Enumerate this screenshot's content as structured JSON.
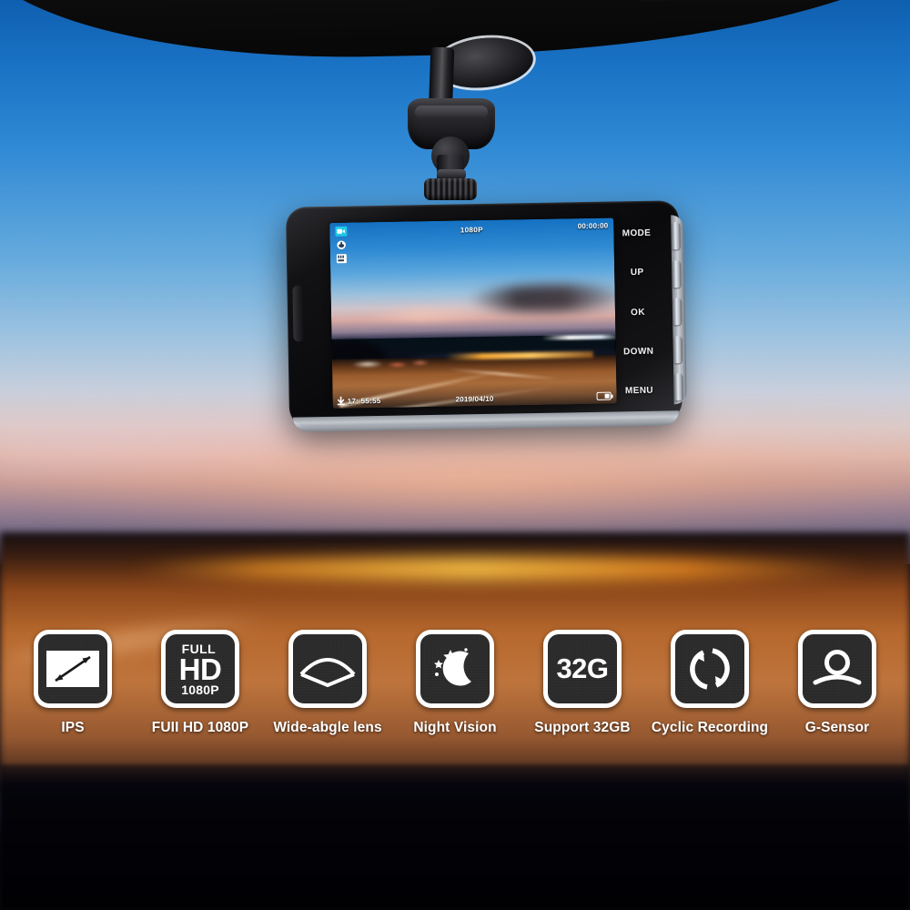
{
  "scene": {
    "title": "Car Dash Cam Product Feature Image",
    "setting": "dash camera mounted on windshield at sunset"
  },
  "device": {
    "name": "dash-cam",
    "screen": {
      "osd": {
        "resolution": "1080P",
        "record_timer": "00:00:00",
        "time": "17: 55:55",
        "date": "2019/04/10",
        "status_icons": [
          {
            "name": "video-record-icon",
            "color": "#20c8e8"
          },
          {
            "name": "microphone-icon",
            "color": "#ffffff"
          },
          {
            "name": "sd-card-icon",
            "color": "#ffffff"
          }
        ],
        "battery_icon": "battery-icon"
      },
      "content": "night highway driving scene with motion-blurred light trails"
    },
    "buttons": [
      {
        "label": "MODE",
        "name": "mode-button"
      },
      {
        "label": "UP",
        "name": "up-button"
      },
      {
        "label": "OK",
        "name": "ok-button"
      },
      {
        "label": "DOWN",
        "name": "down-button"
      },
      {
        "label": "MENU",
        "name": "menu-button"
      }
    ]
  },
  "mount": {
    "name": "suction-cup-mount",
    "parts": [
      "suction-cup",
      "ball-joint",
      "thumb-screw"
    ]
  },
  "features": [
    {
      "label": "IPS",
      "icon": "ips-display-icon"
    },
    {
      "label": "FUII HD 1080P",
      "icon": "full-hd-icon",
      "lines": {
        "top": "FULL",
        "mid": "HD",
        "bottom": "1080P"
      }
    },
    {
      "label": "Wide-abgle lens",
      "icon": "wide-angle-lens-icon"
    },
    {
      "label": "Night Vision",
      "icon": "night-vision-icon"
    },
    {
      "label": "Support 32GB",
      "icon": "storage-icon",
      "text": "32G"
    },
    {
      "label": "Cyclic Recording",
      "icon": "cyclic-recording-icon"
    },
    {
      "label": "G-Sensor",
      "icon": "g-sensor-icon"
    }
  ],
  "colors": {
    "sky_blue": "#1a72c4",
    "sunset_orange": "#b6682d",
    "road_amber": "#a86b3a",
    "icon_bg": "#2b2b2b",
    "icon_border": "#ffffff",
    "label_text": "#ffffff",
    "osd_accent": "#20c8e8"
  }
}
